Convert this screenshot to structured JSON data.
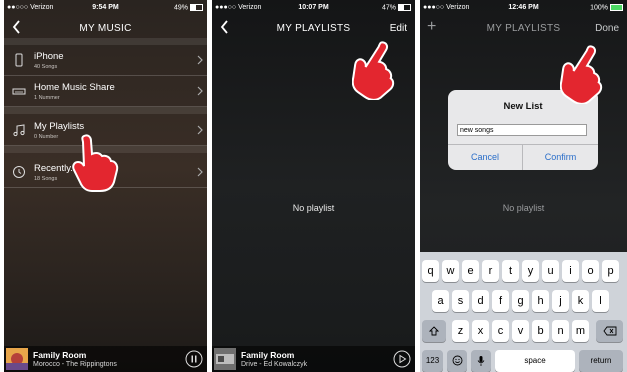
{
  "colors": {
    "hand": "#e3262f",
    "link_blue": "#2a6ec9",
    "battery_green": "#4cd964"
  },
  "screen1": {
    "status": {
      "carrier": "●●○○○ Verizon",
      "time": "9:54 PM",
      "battery": "49%"
    },
    "title": "MY MUSIC",
    "items": [
      {
        "label": "iPhone",
        "sub": "40 Songs",
        "icon": "phone-icon"
      },
      {
        "label": "Home Music Share",
        "sub": "1 Nummer",
        "icon": "music-share-icon"
      },
      {
        "label": "My Playlists",
        "sub": "0 Number",
        "icon": "music-note-icon"
      },
      {
        "label": "Recently...",
        "sub": "18 Songs",
        "icon": "clock-icon"
      }
    ],
    "now_playing": {
      "room": "Family Room",
      "track": "Morocco - The Rippingtons",
      "control": "pause-icon"
    }
  },
  "screen2": {
    "status": {
      "carrier": "●●●○○ Verizon",
      "time": "10:07 PM",
      "battery": "47%"
    },
    "title": "MY PLAYLISTS",
    "edit_label": "Edit",
    "empty_text": "No playlist",
    "now_playing": {
      "room": "Family Room",
      "track": "Drive - Ed Kowalczyk",
      "control": "play-icon"
    }
  },
  "screen3": {
    "status": {
      "carrier": "●●●○○ Verizon",
      "time": "12:46 PM",
      "battery": "100%"
    },
    "title": "MY PLAYLISTS",
    "add_label": "+",
    "done_label": "Done",
    "empty_text": "No playlist",
    "dialog": {
      "title": "New List",
      "input_value": "new songs",
      "cancel_label": "Cancel",
      "confirm_label": "Confirm"
    },
    "keyboard": {
      "row1": [
        "q",
        "w",
        "e",
        "r",
        "t",
        "y",
        "u",
        "i",
        "o",
        "p"
      ],
      "row2": [
        "a",
        "s",
        "d",
        "f",
        "g",
        "h",
        "j",
        "k",
        "l"
      ],
      "row3": [
        "z",
        "x",
        "c",
        "v",
        "b",
        "n",
        "m"
      ],
      "num_label": "123",
      "space_label": "space",
      "return_label": "return"
    }
  }
}
